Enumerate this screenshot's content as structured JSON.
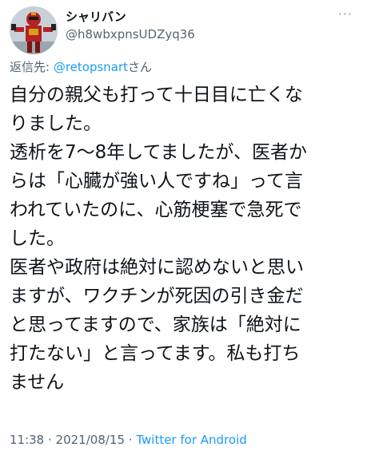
{
  "author": {
    "display_name": "シャリバン",
    "handle": "@h8wbxpnsUDZyq36"
  },
  "more_menu": "···",
  "reply": {
    "prefix": "返信先: ",
    "mention": "@retopsnart",
    "suffix": "さん"
  },
  "body_lines": [
    "自分の親父も打って十日目に亡くな",
    "りました。",
    "透析を7〜8年してましたが、医者か",
    "らは「心臓が強い人ですね」って言",
    "われていたのに、心筋梗塞で急死で",
    "した。",
    "医者や政府は絶対に認めないと思い",
    "ますが、ワクチンが死因の引き金だ",
    "と思ってますので、家族は「絶対に",
    "打たない」と言ってます。私も打ち",
    "ません"
  ],
  "meta": {
    "time": "11:38",
    "sep1": " · ",
    "date": "2021/08/15",
    "sep2": " · ",
    "source": "Twitter for Android"
  },
  "colors": {
    "link": "#1d9bf0",
    "secondary_text": "#536471",
    "primary_text": "#0f1419"
  }
}
